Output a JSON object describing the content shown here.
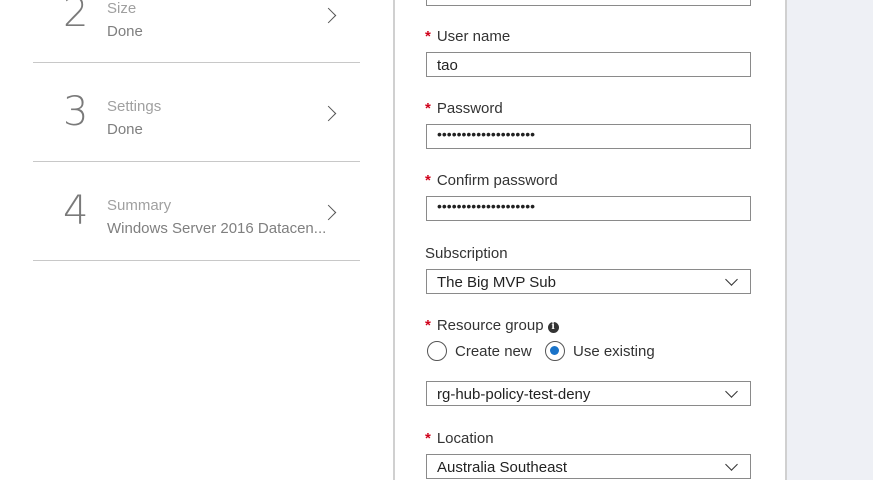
{
  "steps": [
    {
      "num": "2",
      "title": "Size",
      "sub": "Done"
    },
    {
      "num": "3",
      "title": "Settings",
      "sub": "Done"
    },
    {
      "num": "4",
      "title": "Summary",
      "sub": "Windows Server 2016 Datacen..."
    }
  ],
  "form": {
    "required_mark": "*",
    "username": {
      "label": "User name",
      "value": "tao"
    },
    "password": {
      "label": "Password",
      "value": "••••••••••••••••••••"
    },
    "confirm_password": {
      "label": "Confirm password",
      "value": "••••••••••••••••••••"
    },
    "subscription": {
      "label": "Subscription",
      "value": "The Big MVP Sub"
    },
    "resource_group": {
      "label": "Resource group",
      "info_icon": "i",
      "option_new": "Create new",
      "option_existing": "Use existing",
      "selected": "Use existing",
      "value": "rg-hub-policy-test-deny"
    },
    "location": {
      "label": "Location",
      "value": "Australia Southeast"
    }
  }
}
